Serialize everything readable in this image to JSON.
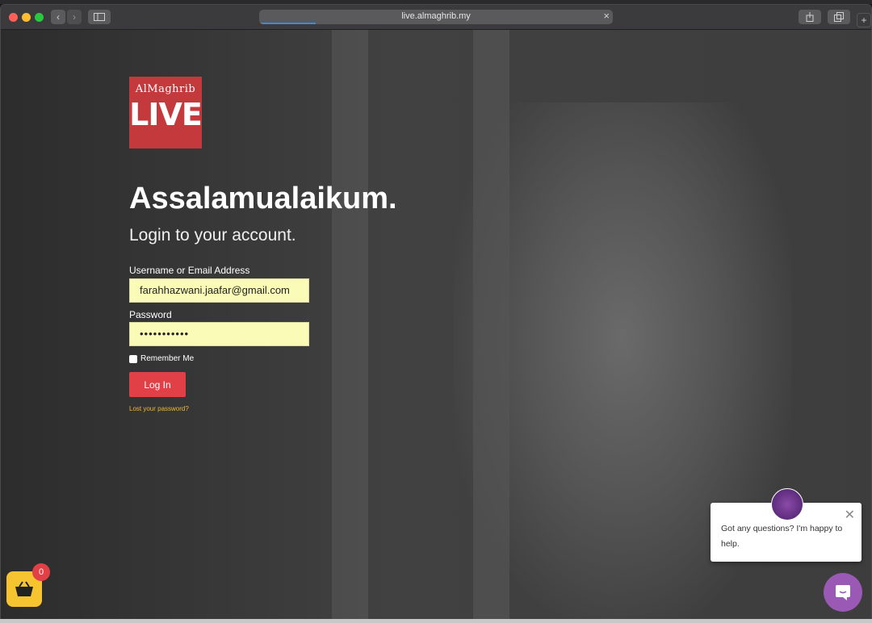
{
  "browser": {
    "url": "live.almaghrib.my",
    "load_progress": 0.16
  },
  "logo": {
    "brand": "AlMaghrib",
    "live": "LIVE"
  },
  "login": {
    "greeting": "Assalamualaikum.",
    "subtitle": "Login to your account.",
    "username_label": "Username or Email Address",
    "username_value": "farahhazwani.jaafar@gmail.com",
    "password_label": "Password",
    "password_value": "•••••••••••",
    "remember_label": "Remember Me",
    "login_button": "Log In",
    "lost_password": "Lost your password?"
  },
  "chat": {
    "message": "Got any questions? I'm happy to help.",
    "close": "✕"
  },
  "cart": {
    "count": "0"
  },
  "colors": {
    "accent": "#e14046",
    "logo": "#c4393c",
    "link": "#f0b63a",
    "chat": "#9b59b6",
    "cart": "#f6c331"
  }
}
